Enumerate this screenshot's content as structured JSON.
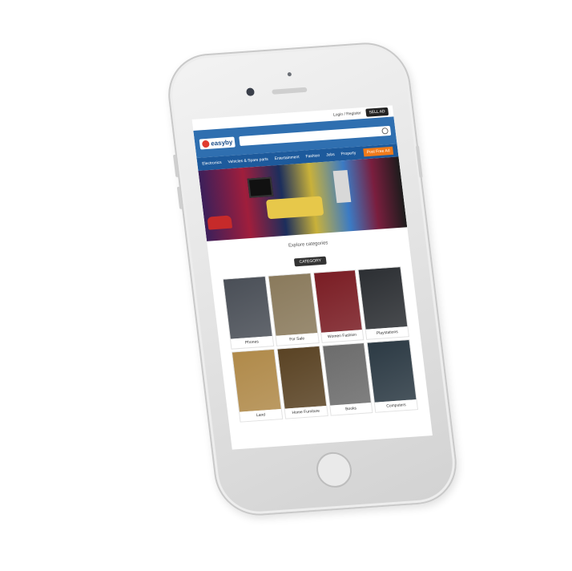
{
  "header": {
    "login_label": "Login / Register",
    "sell_label": "SELL AD",
    "logo_text": "easyby"
  },
  "nav": {
    "items": [
      "Electronics",
      "Vehicles & Spare parts",
      "Entertainment",
      "Fashion",
      "Jobs",
      "Property"
    ],
    "ad_label": "Post Free Ad"
  },
  "banner": {},
  "explore": {
    "title": "Explore categories",
    "category_label": "CATEGORY"
  },
  "categories": [
    {
      "label": "Phones",
      "color": "#4a4f57"
    },
    {
      "label": "For Sale",
      "color": "#8a7a5c"
    },
    {
      "label": "Women Fashion",
      "color": "#7a1d24"
    },
    {
      "label": "Playstations",
      "color": "#2c2f33"
    },
    {
      "label": "Land",
      "color": "#b08a4a"
    },
    {
      "label": "Home Furniture",
      "color": "#5a4324"
    },
    {
      "label": "Books",
      "color": "#6c6c6c"
    },
    {
      "label": "Computers",
      "color": "#2c3a44"
    }
  ]
}
